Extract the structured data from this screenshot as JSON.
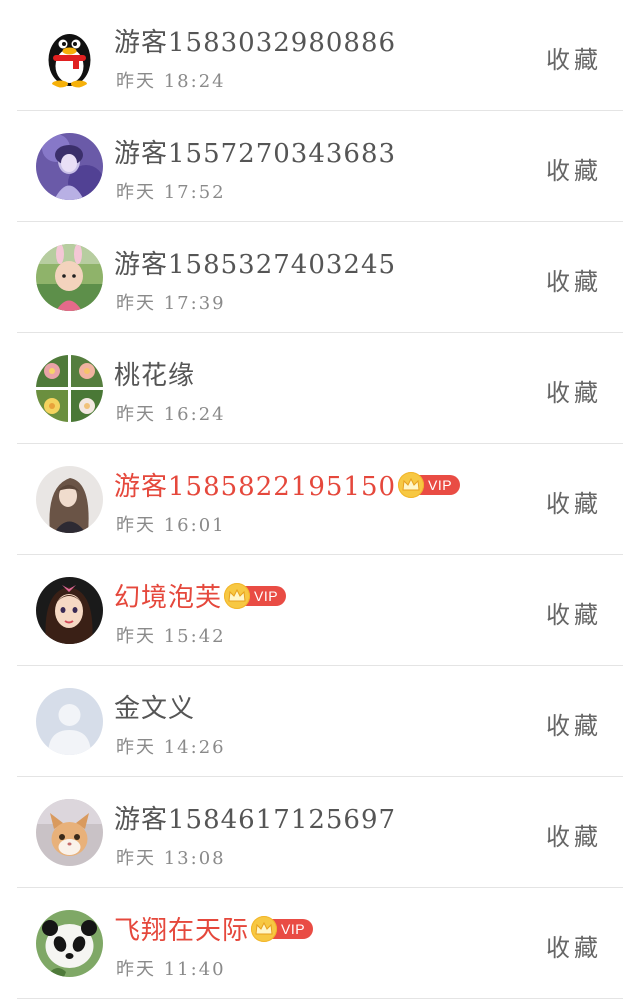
{
  "colors": {
    "name_normal": "#555555",
    "name_vip": "#e5483c",
    "time": "#8a8a8a",
    "fav": "#666666",
    "vip_tag_bg": "#e94c44",
    "vip_crown": "#f7c843",
    "divider": "#e4e4e4"
  },
  "visitors": [
    {
      "name": "游客1583032980886",
      "time": "昨天 18:24",
      "vip": false,
      "avatar": "qq-penguin-avatar",
      "fav_label": "收藏"
    },
    {
      "name": "游客1557270343683",
      "time": "昨天 17:52",
      "vip": false,
      "avatar": "girl-portrait-avatar",
      "fav_label": "收藏"
    },
    {
      "name": "游客1585327403245",
      "time": "昨天 17:39",
      "vip": false,
      "avatar": "child-bunny-ears-avatar",
      "fav_label": "收藏"
    },
    {
      "name": "桃花缘",
      "time": "昨天 16:24",
      "vip": false,
      "avatar": "flowers-collage-avatar",
      "fav_label": "收藏"
    },
    {
      "name": "游客1585822195150",
      "time": "昨天 16:01",
      "vip": true,
      "vip_label": "VIP",
      "avatar": "long-hair-girl-avatar",
      "fav_label": "收藏"
    },
    {
      "name": "幻境泡芙",
      "time": "昨天 15:42",
      "vip": true,
      "vip_label": "VIP",
      "avatar": "cartoon-girl-avatar",
      "fav_label": "收藏"
    },
    {
      "name": "金文义",
      "time": "昨天 14:26",
      "vip": false,
      "avatar": "default-user-avatar",
      "fav_label": "收藏"
    },
    {
      "name": "游客1584617125697",
      "time": "昨天 13:08",
      "vip": false,
      "avatar": "kitten-avatar",
      "fav_label": "收藏"
    },
    {
      "name": "飞翔在天际",
      "time": "昨天 11:40",
      "vip": true,
      "vip_label": "VIP",
      "avatar": "panda-avatar",
      "fav_label": "收藏"
    }
  ]
}
